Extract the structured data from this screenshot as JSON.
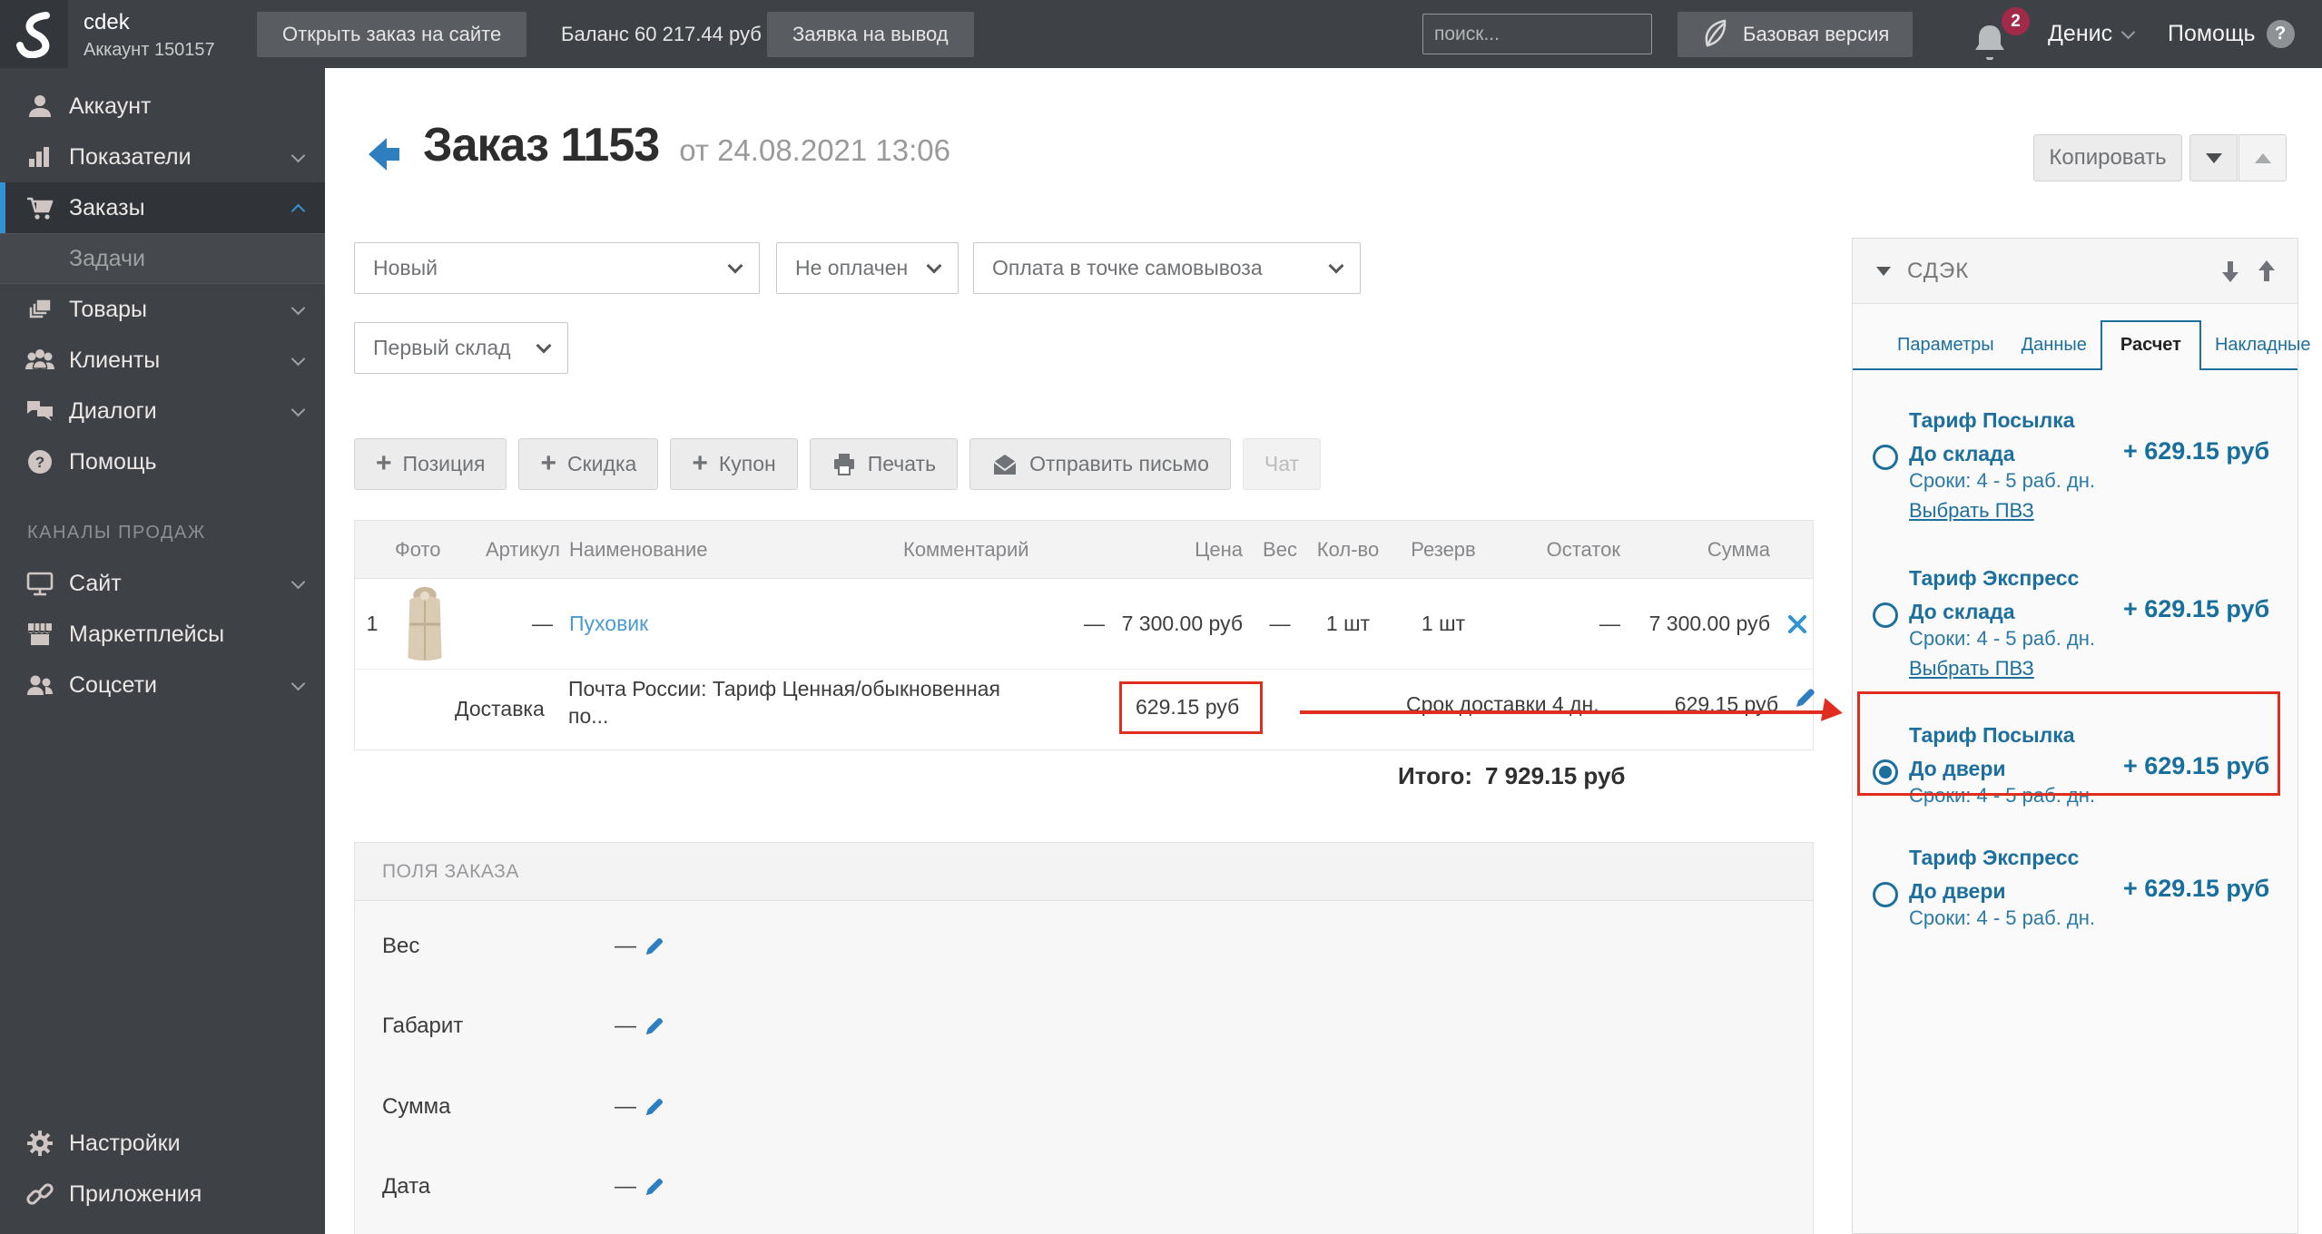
{
  "topbar": {
    "logo_title": "cdek",
    "logo_subtitle": "Аккаунт 150157",
    "open_order_button": "Открыть заказ на сайте",
    "balance": "Баланс 60 217.44 руб",
    "withdraw_button": "Заявка на вывод",
    "search_placeholder": "поиск...",
    "version_button": "Базовая версия",
    "notification_count": "2",
    "user_name": "Денис",
    "help_label": "Помощь",
    "help_glyph": "?"
  },
  "sidebar": {
    "items": [
      {
        "label": "Аккаунт"
      },
      {
        "label": "Показатели"
      },
      {
        "label": "Заказы"
      },
      {
        "label": "Задачи"
      },
      {
        "label": "Товары"
      },
      {
        "label": "Клиенты"
      },
      {
        "label": "Диалоги"
      },
      {
        "label": "Помощь"
      }
    ],
    "section_title": "КАНАЛЫ ПРОДАЖ",
    "channels": [
      {
        "label": "Сайт"
      },
      {
        "label": "Маркетплейсы"
      },
      {
        "label": "Соцсети"
      }
    ],
    "bottom": [
      {
        "label": "Настройки"
      },
      {
        "label": "Приложения"
      }
    ]
  },
  "order_header": {
    "title": "Заказ 1153",
    "date": "от 24.08.2021 13:06",
    "copy_button": "Копировать"
  },
  "filters": {
    "status": "Новый",
    "payment_status": "Не оплачен",
    "payment_method": "Оплата в точке самовывоза",
    "warehouse": "Первый склад"
  },
  "actions": {
    "add_position": "Позиция",
    "add_discount": "Скидка",
    "add_coupon": "Купон",
    "print": "Печать",
    "send_email": "Отправить письмо",
    "chat": "Чат"
  },
  "items_table": {
    "headers": [
      "Фото",
      "Артикул",
      "Наименование",
      "Комментарий",
      "Цена",
      "Вес",
      "Кол-во",
      "Резерв",
      "Остаток",
      "Сумма"
    ],
    "row": {
      "num": "1",
      "sku": "—",
      "name": "Пуховик",
      "comment": "—",
      "price": "7 300.00 руб",
      "weight": "—",
      "qty": "1 шт",
      "reserve": "1 шт",
      "stock": "—",
      "sum": "7 300.00 руб"
    },
    "delivery": {
      "label": "Доставка",
      "name": "Почта России: Тариф Ценная/обыкновенная по...",
      "price": "629.15 руб",
      "term": "Срок доставки 4 дн.",
      "sum": "629.15 руб"
    },
    "total_label": "Итого:",
    "total_value": "7 929.15 руб"
  },
  "order_fields": {
    "title": "ПОЛЯ ЗАКАЗА",
    "fields": [
      {
        "label": "Вес",
        "value": "—"
      },
      {
        "label": "Габарит",
        "value": "—"
      },
      {
        "label": "Сумма",
        "value": "—"
      },
      {
        "label": "Дата",
        "value": "—"
      }
    ]
  },
  "cdek_panel": {
    "title": "СДЭК",
    "tabs": [
      {
        "label": "Параметры"
      },
      {
        "label": "Данные"
      },
      {
        "label": "Расчет"
      },
      {
        "label": "Накладные"
      }
    ],
    "active_tab": "Расчет",
    "tariffs": [
      {
        "name": "Тариф Посылка",
        "mode": "До склада",
        "terms": "Сроки: 4 - 5 раб. дн.",
        "pvz_link": "Выбрать ПВЗ",
        "price": "+ 629.15 руб",
        "selected": false
      },
      {
        "name": "Тариф Экспресс",
        "mode": "До склада",
        "terms": "Сроки: 4 - 5 раб. дн.",
        "pvz_link": "Выбрать ПВЗ",
        "price": "+ 629.15 руб",
        "selected": false
      },
      {
        "name": "Тариф Посылка",
        "mode": "До двери",
        "terms": "Сроки: 4 - 5 раб. дн.",
        "price": "+ 629.15 руб",
        "selected": true,
        "highlighted": true
      },
      {
        "name": "Тариф Экспресс",
        "mode": "До двери",
        "terms": "Сроки: 4 - 5 раб. дн.",
        "price": "+ 629.15 руб",
        "selected": false
      }
    ]
  },
  "colors": {
    "sidebar_bg": "#3e4247",
    "active_item_accent": "#3193d4",
    "panel_blue": "#1d6f9e",
    "link_blue": "#4a9bd0",
    "annotation_red": "#e02d20",
    "badge_red": "#a12a48"
  }
}
